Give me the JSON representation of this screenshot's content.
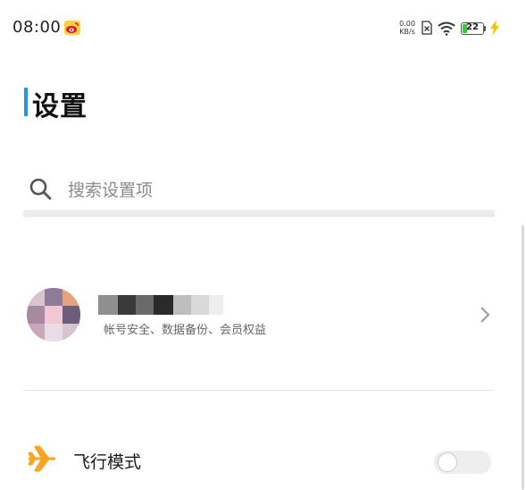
{
  "status_bar": {
    "time": "08:00",
    "net_speed_value": "0.00",
    "net_speed_unit": "KB/s",
    "battery_level": "22",
    "battery_fraction": 0.22,
    "icons": [
      "weibo-icon",
      "sim-icon",
      "wifi-icon",
      "battery-icon",
      "charging-bolt-icon"
    ]
  },
  "header": {
    "title": "设置",
    "accent_color": "#2196e8"
  },
  "search": {
    "placeholder": "搜索设置项",
    "icon": "search-icon"
  },
  "account": {
    "name": "",
    "subtitle": "帐号安全、数据备份、会员权益",
    "icons": [
      "avatar",
      "chevron-right-icon"
    ]
  },
  "settings": {
    "items": [
      {
        "label": "飞行模式",
        "icon": "airplane-icon",
        "icon_color": "#f5a623",
        "toggle_on": false
      }
    ]
  },
  "colors": {
    "battery_green": "#3ec63e",
    "bolt_yellow": "#f2c200",
    "weibo_red": "#e6162d"
  }
}
